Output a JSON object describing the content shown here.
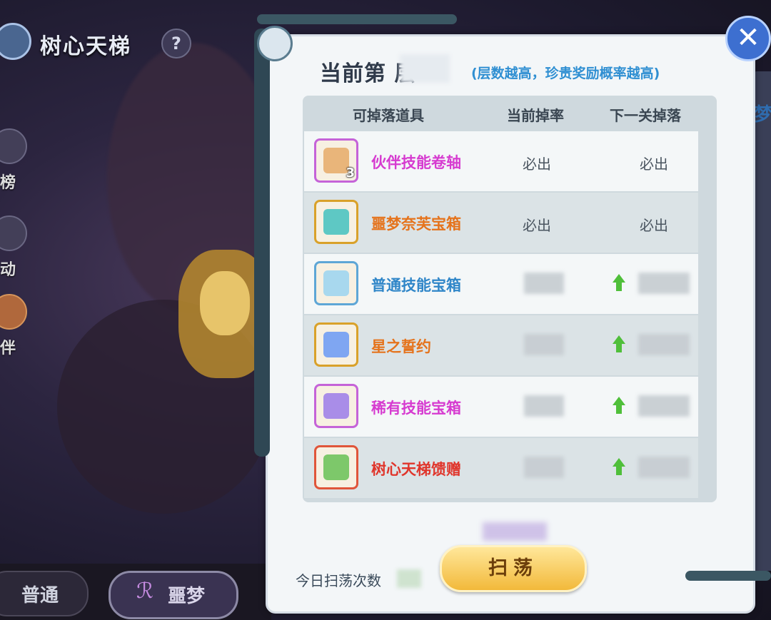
{
  "game": {
    "title": "树心天梯",
    "help_glyph": "?",
    "side_labels": [
      "榜",
      "动",
      "伴"
    ],
    "side_edge_char": "梦"
  },
  "modes": {
    "normal_label": "普通",
    "normal_glyph": "ℛ",
    "nightmare_label": "噩梦",
    "nightmare_glyph": "ℛ"
  },
  "panel": {
    "floor_title": "当前第  层",
    "floor_hint": "(层数越高，珍贵奖励概率越高)",
    "close_glyph": "✕",
    "columns": [
      "可掉落道具",
      "当前掉率",
      "下一关掉落"
    ],
    "rows": [
      {
        "name": "伙伴技能卷轴",
        "name_color": "#d63bd0",
        "icon_border": "#c563d8",
        "icon_fill": "#e9b57a",
        "count": "3",
        "current": "必出",
        "next": "必出",
        "arrow": false
      },
      {
        "name": "噩梦奈芙宝箱",
        "name_color": "#e5731c",
        "icon_border": "#d9a12a",
        "icon_fill": "#5ec8c4",
        "count": "",
        "current": "必出",
        "next": "必出",
        "arrow": false
      },
      {
        "name": "普通技能宝箱",
        "name_color": "#2f86c8",
        "icon_border": "#5ea6d6",
        "icon_fill": "#a8d8ee",
        "count": "",
        "current": "",
        "next": "",
        "arrow": true
      },
      {
        "name": "星之誓约",
        "name_color": "#e5731c",
        "icon_border": "#d9a12a",
        "icon_fill": "#7fa6f2",
        "count": "",
        "current": "",
        "next": "",
        "arrow": true
      },
      {
        "name": "稀有技能宝箱",
        "name_color": "#d63bd0",
        "icon_border": "#c563d8",
        "icon_fill": "#a98de8",
        "count": "",
        "current": "",
        "next": "",
        "arrow": true
      },
      {
        "name": "树心天梯馈赠",
        "name_color": "#e0352b",
        "icon_border": "#e0553a",
        "icon_fill": "#7dc86a",
        "count": "",
        "current": "",
        "next": "",
        "arrow": true
      }
    ],
    "sweep_label": "扫荡",
    "sweep_count_label": "今日扫荡次数"
  }
}
